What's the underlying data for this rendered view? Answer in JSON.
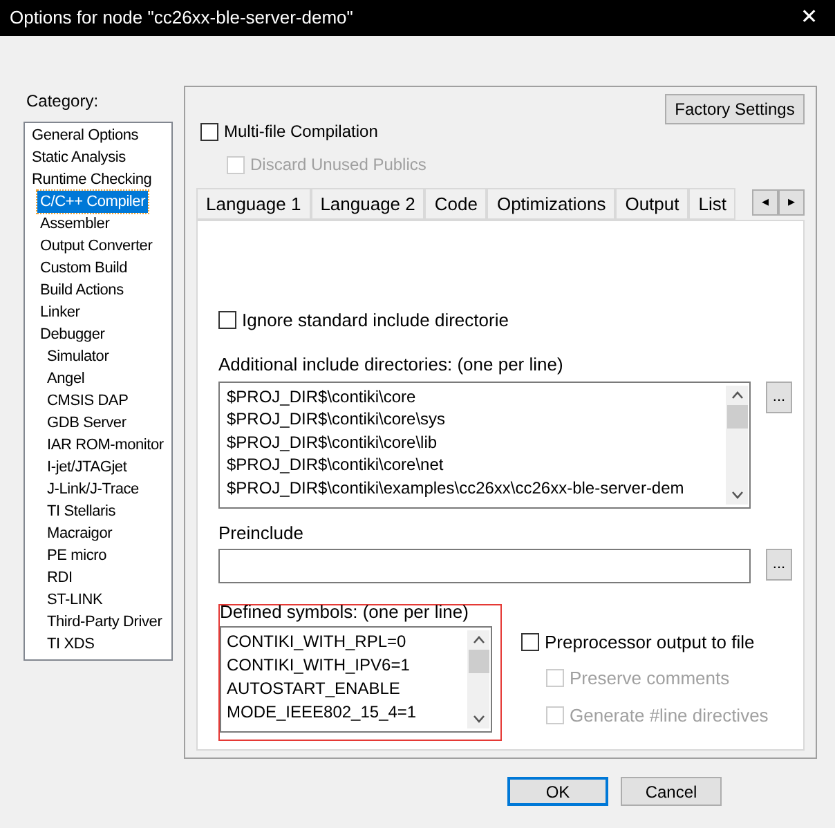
{
  "window": {
    "title": "Options for node \"cc26xx-ble-server-demo\"",
    "close": "✕"
  },
  "category": {
    "label": "Category:",
    "items": [
      {
        "label": "General Options",
        "selected": false
      },
      {
        "label": "Static Analysis",
        "selected": false
      },
      {
        "label": "Runtime Checking",
        "selected": false,
        "children": [
          {
            "label": "C/C++ Compiler",
            "selected": true
          },
          {
            "label": "Assembler",
            "selected": false
          },
          {
            "label": "Output Converter",
            "selected": false
          },
          {
            "label": "Custom Build",
            "selected": false
          },
          {
            "label": "Build Actions",
            "selected": false
          },
          {
            "label": "Linker",
            "selected": false
          },
          {
            "label": "Debugger",
            "selected": false,
            "children": [
              {
                "label": "Simulator",
                "selected": false
              },
              {
                "label": "Angel",
                "selected": false
              },
              {
                "label": "CMSIS DAP",
                "selected": false
              },
              {
                "label": "GDB Server",
                "selected": false
              },
              {
                "label": "IAR ROM-monitor",
                "selected": false
              },
              {
                "label": "I-jet/JTAGjet",
                "selected": false
              },
              {
                "label": "J-Link/J-Trace",
                "selected": false
              },
              {
                "label": "TI Stellaris",
                "selected": false
              },
              {
                "label": "Macraigor",
                "selected": false
              },
              {
                "label": "PE micro",
                "selected": false
              },
              {
                "label": "RDI",
                "selected": false
              },
              {
                "label": "ST-LINK",
                "selected": false
              },
              {
                "label": "Third-Party Driver",
                "selected": false
              },
              {
                "label": "TI XDS",
                "selected": false
              }
            ]
          }
        ]
      }
    ]
  },
  "factory_settings": "Factory Settings",
  "options": [
    {
      "label": "Multi-file Compilation",
      "checked": false,
      "disabled": false
    },
    {
      "label": "Discard Unused Publics",
      "checked": false,
      "disabled": true
    }
  ],
  "tabs": [
    {
      "label": "Language 1",
      "selected": false
    },
    {
      "label": "Language 2",
      "selected": false
    },
    {
      "label": "Code",
      "selected": false
    },
    {
      "label": "Optimizations",
      "selected": false
    },
    {
      "label": "Output",
      "selected": false
    },
    {
      "label": "List",
      "selected": false
    }
  ],
  "tab_scroll": [
    "◂",
    "▸"
  ],
  "ignore_standard": {
    "label": "Ignore standard include directorie",
    "checked": false
  },
  "include_dirs": {
    "label": "Additional include directories: (one per line)",
    "lines": [
      "$PROJ_DIR$\\contiki\\core",
      "$PROJ_DIR$\\contiki\\core\\sys",
      "$PROJ_DIR$\\contiki\\core\\lib",
      "$PROJ_DIR$\\contiki\\core\\net",
      "$PROJ_DIR$\\contiki\\examples\\cc26xx\\cc26xx-ble-server-dem"
    ],
    "browse": "..."
  },
  "preinclude": {
    "label": "Preinclude",
    "browse": "..."
  },
  "defined_symbols": {
    "label": "Defined symbols: (one per line)",
    "highlighted": true,
    "lines": [
      "CONTIKI_WITH_RPL=0",
      "CONTIKI_WITH_IPV6=1",
      "AUTOSTART_ENABLE",
      "MODE_IEEE802_15_4=1"
    ]
  },
  "preprocessor": [
    {
      "label": "Preprocessor output to file",
      "checked": false,
      "disabled": false
    },
    {
      "label": "Preserve comments",
      "checked": false,
      "disabled": true
    },
    {
      "label": "Generate #line directives",
      "checked": false,
      "disabled": true
    }
  ],
  "buttons": [
    {
      "label": "OK",
      "default": true
    },
    {
      "label": "Cancel",
      "default": false
    }
  ]
}
